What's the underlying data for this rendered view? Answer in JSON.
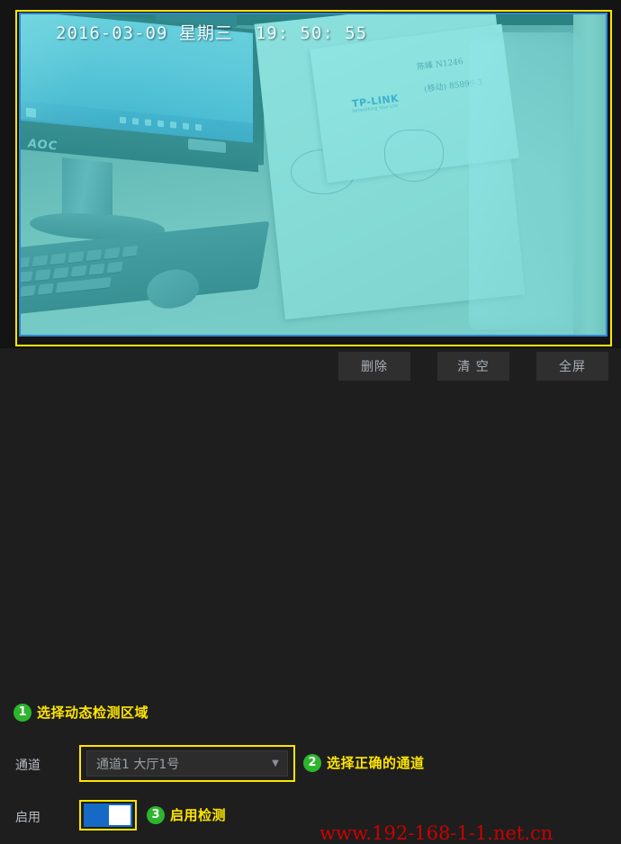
{
  "video": {
    "timestamp": "2016-03-09 星期三  19: 50: 55",
    "scene_brand": "AOC",
    "paper_brand": "TP-LINK",
    "paper_brand_sub": "Networking Your Life",
    "handnotes": [
      "陈峰  N1246",
      "(移动) 85899-3"
    ],
    "motion_overlay_color": "#40d6d6",
    "highlight_color": "#ffe500",
    "frame_border_color": "#2f86d0"
  },
  "toolbar": {
    "delete_label": "删除",
    "clear_label": "清 空",
    "fullscreen_label": "全屏"
  },
  "annotations": [
    {
      "number": "1",
      "text": "选择动态检测区域"
    },
    {
      "number": "2",
      "text": "选择正确的通道"
    },
    {
      "number": "3",
      "text": "启用检测"
    }
  ],
  "form": {
    "channel_label": "通道",
    "channel_value": "通道1 大厅1号",
    "channel_caret": "▼",
    "channel_options": [
      "通道1 大厅1号"
    ],
    "enable_label": "启用",
    "enable_state": "on"
  },
  "watermark": {
    "text": "www.192-168-1-1.net.cn",
    "color": "#cc0000"
  }
}
